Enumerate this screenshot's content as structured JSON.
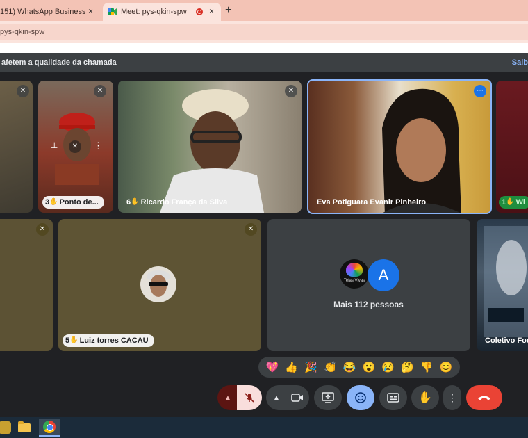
{
  "browser": {
    "tabs": [
      {
        "label": "151) WhatsApp Business",
        "active": false
      },
      {
        "label": "Meet: pys-qkin-spw",
        "active": true
      }
    ],
    "new_tab": "+",
    "close": "×",
    "address": "pys-qkin-spw"
  },
  "banner": {
    "text": "afetem a qualidade da chamada",
    "more": "Saib"
  },
  "tiles": {
    "ponto": {
      "hand_count": "3",
      "name": "Ponto de..."
    },
    "ricardo": {
      "hand_count": "6",
      "name": "Ricardo França da Silva"
    },
    "eva": {
      "name": "Eva Potiguara Evanir Pinheiro"
    },
    "right_edge": {
      "hand_count": "1",
      "name": "Wi"
    },
    "luiz": {
      "hand_count": "5",
      "name": "Luiz torres CACAU"
    },
    "more": {
      "avatar_letter": "A",
      "avatar_logo_text": "Telas Vivas",
      "label": "Mais 112 pessoas"
    },
    "coletivo": {
      "name": "Coletivo Foc"
    }
  },
  "reactions": [
    "💖",
    "👍",
    "🎉",
    "👏",
    "😂",
    "😮",
    "😢",
    "🤔",
    "👎",
    "😊"
  ],
  "controls": {
    "mic_options": "▲",
    "mic": "mic-off",
    "cam_options": "▲",
    "cam": "camera",
    "present": "present",
    "emoji": "emoji",
    "captions": "captions",
    "raise_hand": "raise-hand",
    "more": "⋮",
    "leave": "leave-call"
  },
  "colors": {
    "meet_bg": "#202124",
    "tile_bg": "#3c4043",
    "accent": "#8ab4f8",
    "leave": "#ea4335",
    "mic_off": "#f9dedc"
  }
}
